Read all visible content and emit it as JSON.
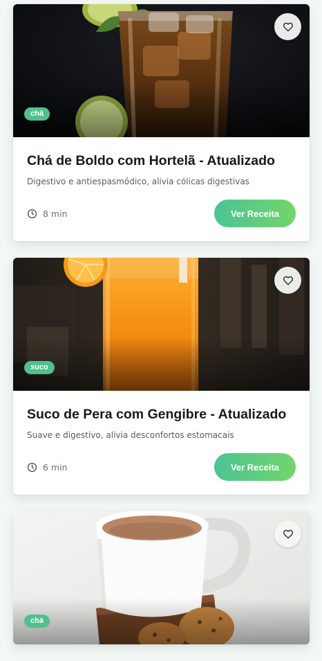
{
  "recipes": [
    {
      "tag": "chá",
      "title": "Chá de Boldo com Hortelã - Atualizado",
      "description": "Digestivo e antiespasmódico, alivia cólicas digestivas",
      "time": "8 min",
      "button_label": "Ver Receita",
      "image_icon": "iced-tea-glass-photo"
    },
    {
      "tag": "suco",
      "title": "Suco de Pera com Gengibre - Atualizado",
      "description": "Suave e digestivo, alivia desconfortos estomacais",
      "time": "6 min",
      "button_label": "Ver Receita",
      "image_icon": "orange-juice-glass-photo"
    },
    {
      "tag": "chá",
      "image_icon": "tea-cup-cookies-photo"
    }
  ],
  "icons": {
    "favorite": "heart-icon",
    "time": "clock-icon"
  },
  "colors": {
    "accent_start": "#4cc394",
    "accent_end": "#72d66c",
    "tag": "#4fc18e",
    "background": "#f3f8f6",
    "title": "#141a1f"
  }
}
